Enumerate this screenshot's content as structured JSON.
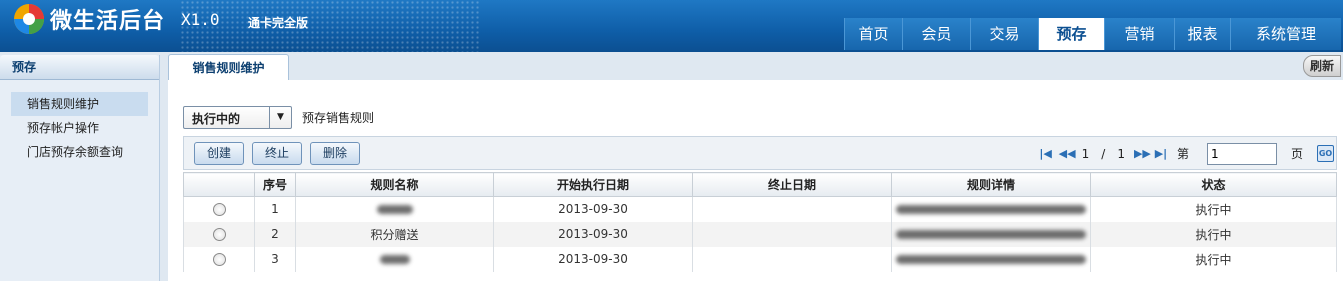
{
  "header": {
    "title": "微生活后台",
    "version": "X1.0",
    "edition": "通卡完全版",
    "nav": [
      {
        "label": "首页",
        "active": false
      },
      {
        "label": "会员",
        "active": false
      },
      {
        "label": "交易",
        "active": false
      },
      {
        "label": "预存",
        "active": true
      },
      {
        "label": "营销",
        "active": false
      },
      {
        "label": "报表",
        "active": false
      },
      {
        "label": "系统管理",
        "active": false
      }
    ]
  },
  "sidebar": {
    "title": "预存",
    "items": [
      {
        "label": "销售规则维护",
        "active": true
      },
      {
        "label": "预存帐户操作",
        "active": false
      },
      {
        "label": "门店预存余额查询",
        "active": false
      }
    ]
  },
  "tabs": {
    "active_tab": "销售规则维护",
    "refresh_label": "刷新"
  },
  "filter": {
    "selected": "执行中的",
    "label": "预存销售规则"
  },
  "toolbar": {
    "create_label": "创建",
    "stop_label": "终止",
    "delete_label": "删除"
  },
  "pager": {
    "current_page": "1",
    "separator": "/",
    "total_pages": "1",
    "goto_prefix": "第",
    "goto_value": "1",
    "goto_suffix": "页",
    "go_label": "GO"
  },
  "table": {
    "columns": [
      "",
      "序号",
      "规则名称",
      "开始执行日期",
      "终止日期",
      "规则详情",
      "状态"
    ],
    "rows": [
      {
        "index": "1",
        "name": "",
        "start_date": "2013-09-30",
        "end_date": "",
        "detail": "",
        "status": "执行中"
      },
      {
        "index": "2",
        "name": "积分赠送",
        "start_date": "2013-09-30",
        "end_date": "",
        "detail": "",
        "status": "执行中"
      },
      {
        "index": "3",
        "name": "",
        "start_date": "2013-09-30",
        "end_date": "",
        "detail": "",
        "status": "执行中"
      }
    ]
  },
  "colors": {
    "brand": "#0f5ea8",
    "status_active": "#2a9a2a"
  }
}
